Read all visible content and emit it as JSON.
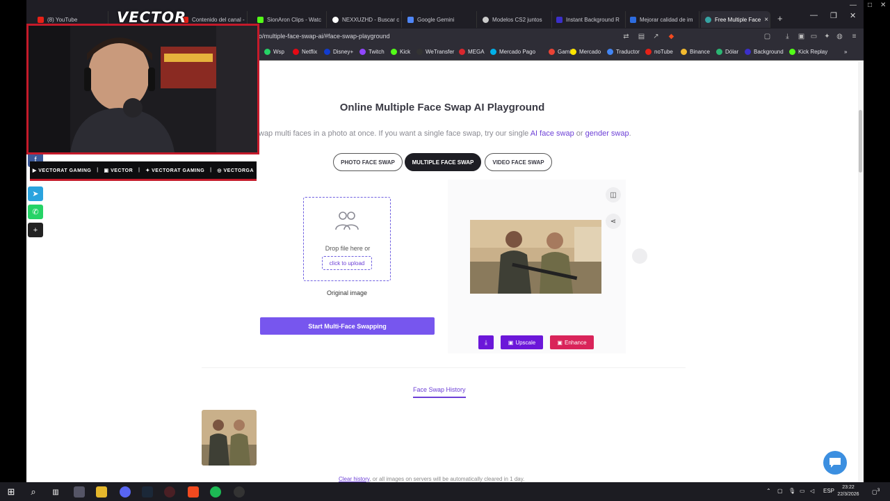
{
  "browser": {
    "tabs": [
      {
        "label": "(8) YouTube",
        "color": "#e62117"
      },
      {
        "label": "Contenido del canal -",
        "color": "#e62117"
      },
      {
        "label": "SionAron Clips - Watc",
        "color": "#53fc18"
      },
      {
        "label": "NEXXUZHD - Buscar c",
        "color": "#ffffff"
      },
      {
        "label": "Google Gemini",
        "color": "#4f86f7"
      },
      {
        "label": "Modelos CS2 juntos",
        "color": "#cccccc"
      },
      {
        "label": "Instant Background R",
        "color": "#3b2fc9"
      },
      {
        "label": "Mejorar calidad de im",
        "color": "#2d6cdf"
      },
      {
        "label": "Free Multiple Face",
        "color": "#36a3a3"
      }
    ],
    "url": "o/multiple-face-swap-ai/#face-swap-playground",
    "bookmarks": [
      {
        "label": "Wsp",
        "color": "#25d366"
      },
      {
        "label": "Netflix",
        "color": "#e50914"
      },
      {
        "label": "Disney+",
        "color": "#113ccf"
      },
      {
        "label": "Twitch",
        "color": "#9146ff"
      },
      {
        "label": "Kick",
        "color": "#53fc18"
      },
      {
        "label": "WeTransfer",
        "color": "#333333"
      },
      {
        "label": "MEGA",
        "color": "#d9272e"
      },
      {
        "label": "Mercado Pago",
        "color": "#00b1ea"
      },
      {
        "label": "Gamil",
        "color": "#ea4335"
      },
      {
        "label": "Mercado",
        "color": "#ffe600"
      },
      {
        "label": "Traductor",
        "color": "#4285f4"
      },
      {
        "label": "noTube",
        "color": "#e62117"
      },
      {
        "label": "Binance",
        "color": "#f3ba2f"
      },
      {
        "label": "Dólar",
        "color": "#2bb673"
      },
      {
        "label": "Background",
        "color": "#3b2fc9"
      },
      {
        "label": "Kick Replay",
        "color": "#53fc18"
      }
    ]
  },
  "page": {
    "title": "Online Multiple Face Swap AI Playground",
    "subtitle_prefix": "wap multi faces in a photo at once. If you want a single face swap, try our single ",
    "subtitle_link1": "AI face swap",
    "subtitle_or": " or ",
    "subtitle_link2": "gender swap",
    "subtitle_end": ".",
    "modes": {
      "photo": "PHOTO FACE SWAP",
      "multiple": "MULTIPLE FACE SWAP",
      "video": "VIDEO FACE SWAP"
    },
    "drop_text": "Drop file here or",
    "upload_label": "click to upload",
    "original_label": "Original image",
    "start_label": "Start Multi-Face Swapping",
    "upscale_label": "Upscale",
    "enhance_label": "Enhance",
    "history_tab": "Face Swap History",
    "clear_link": "Clear history",
    "clear_rest": ", or all images on servers will be automatically cleared in 1 day."
  },
  "overlay": {
    "logo": "VECTOR",
    "socials": [
      {
        "icon": "youtube-icon",
        "top": "VECTORAT",
        "bottom": "GAMING"
      },
      {
        "icon": "twitch-icon",
        "top": "VECTOR",
        "bottom": ""
      },
      {
        "icon": "twitter-icon",
        "top": "VECTORAT",
        "bottom": "GAMING"
      },
      {
        "icon": "instagram-icon",
        "top": "VECTORGA",
        "bottom": ""
      }
    ]
  },
  "taskbar": {
    "lang": "ESP",
    "time": "23:22",
    "date": "22/3/2026",
    "notif_count": "3"
  }
}
